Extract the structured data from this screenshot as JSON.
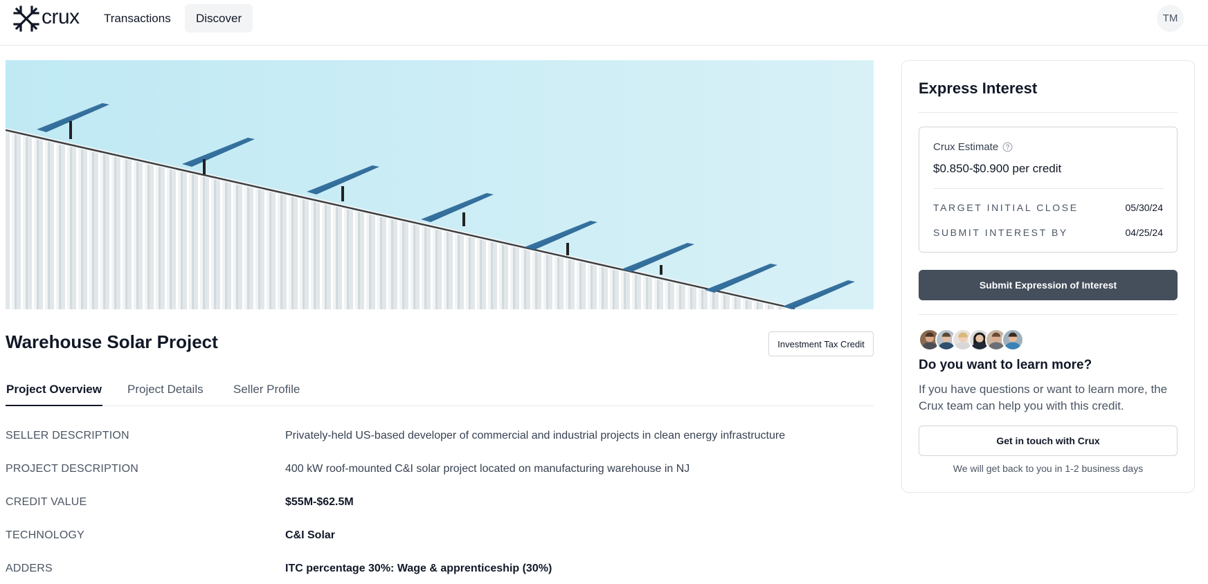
{
  "header": {
    "logo_text": "crux",
    "nav": [
      {
        "label": "Transactions"
      },
      {
        "label": "Discover"
      }
    ],
    "user_initials": "TM"
  },
  "project": {
    "title": "Warehouse Solar Project",
    "badge": "Investment Tax Credit",
    "tabs": [
      {
        "label": "Project Overview",
        "active": true
      },
      {
        "label": "Project Details",
        "active": false
      },
      {
        "label": "Seller Profile",
        "active": false
      }
    ],
    "rows": [
      {
        "label": "SELLER DESCRIPTION",
        "value": "Privately-held US-based developer of commercial and industrial projects in clean energy infrastructure"
      },
      {
        "label": "PROJECT DESCRIPTION",
        "value": "400 kW roof-mounted C&I solar project located on manufacturing warehouse in NJ"
      },
      {
        "label": "CREDIT VALUE",
        "value": "$55M-$62.5M"
      },
      {
        "label": "TECHNOLOGY",
        "value": "C&I Solar"
      },
      {
        "label": "ADDERS",
        "value": "ITC percentage 30%: Wage & apprenticeship (30%)"
      }
    ]
  },
  "interest": {
    "title": "Express Interest",
    "estimate_label": "Crux Estimate",
    "estimate_value": "$0.850-$0.900 per credit",
    "target_close_label": "TARGET INITIAL CLOSE",
    "target_close_date": "05/30/24",
    "submit_by_label": "SUBMIT INTEREST BY",
    "submit_by_date": "04/25/24",
    "submit_button": "Submit Expression of Interest",
    "learn_title": "Do you want to learn more?",
    "learn_text": "If you have questions or want to learn more, the Crux team can help you with this credit.",
    "contact_button": "Get in touch with Crux",
    "response_note": "We will get back to you in 1-2 business days"
  },
  "colors": {
    "primary_button": "#454e5b",
    "sky": "#c6ecf5"
  }
}
